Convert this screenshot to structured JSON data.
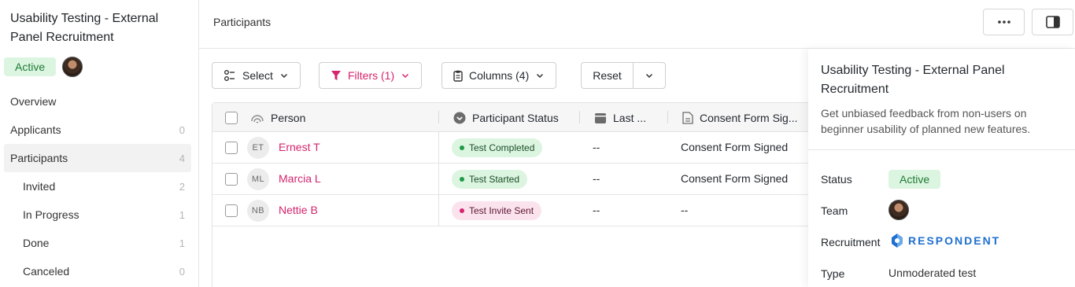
{
  "sidebar": {
    "title": "Usability Testing - External Panel Recruitment",
    "status": "Active",
    "items": [
      {
        "label": "Overview",
        "count": ""
      },
      {
        "label": "Applicants",
        "count": "0"
      },
      {
        "label": "Participants",
        "count": "4"
      },
      {
        "label": "Invited",
        "count": "2"
      },
      {
        "label": "In Progress",
        "count": "1"
      },
      {
        "label": "Done",
        "count": "1"
      },
      {
        "label": "Canceled",
        "count": "0"
      }
    ]
  },
  "header": {
    "breadcrumb": "Participants"
  },
  "toolbar": {
    "select_label": "Select",
    "filters_label": "Filters (1)",
    "columns_label": "Columns (4)",
    "reset_label": "Reset"
  },
  "table": {
    "columns": [
      "Person",
      "Participant Status",
      "Last ...",
      "Consent Form Sig..."
    ],
    "rows": [
      {
        "initials": "ET",
        "name": "Ernest T",
        "status": "Test Completed",
        "last": "--",
        "consent": "Consent Form Signed"
      },
      {
        "initials": "ML",
        "name": "Marcia L",
        "status": "Test Started",
        "last": "--",
        "consent": "Consent Form Signed"
      },
      {
        "initials": "NB",
        "name": "Nettie B",
        "status": "Test Invite Sent",
        "last": "--",
        "consent": "--"
      }
    ]
  },
  "panel": {
    "title": "Usability Testing - External Panel Recruitment",
    "description": "Get unbiased feedback from non-users on beginner usability of planned new features.",
    "status_label": "Status",
    "status_value": "Active",
    "team_label": "Team",
    "recruitment_label": "Recruitment",
    "recruitment_value": "RESPONDENT",
    "type_label": "Type",
    "type_value": "Unmoderated test"
  },
  "colors": {
    "accent": "#d6246e",
    "active_bg": "#dcf5e1",
    "active_text": "#1e7a34",
    "respondent_blue": "#1f6fd1"
  }
}
